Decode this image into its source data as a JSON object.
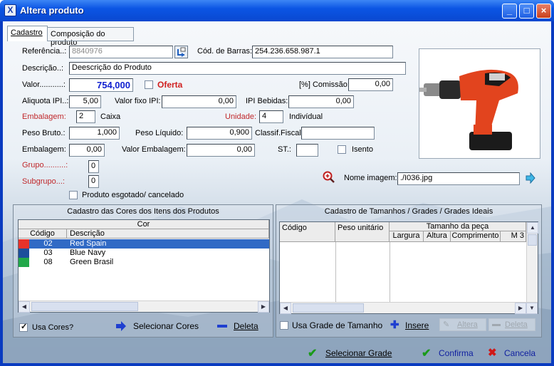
{
  "window": {
    "title": "Altera produto"
  },
  "tabs": [
    "Cadastro",
    "Composição do produto"
  ],
  "form": {
    "referencia_label": "Referência..:",
    "referencia_value": "8840976",
    "cod_barras_label": "Cód. de Barras:",
    "cod_barras_value": "254.236.658.987.1",
    "descricao_label": "Descrição..:",
    "descricao_value": "Deescrição do Produto",
    "valor_label": "Valor...........:",
    "valor_value": "754,000",
    "oferta_label": "Oferta",
    "comissao_label": "[%] Comissão:",
    "comissao_value": "0,00",
    "aliquota_label": "Aliquota IPI..:",
    "aliquota_value": "5,00",
    "valor_fixo_label": "Valor fixo IPI:",
    "valor_fixo_value": "0,00",
    "ipi_bebidas_label": "IPI Bebidas:",
    "ipi_bebidas_value": "0,00",
    "embalagem_label": "Embalagem:",
    "embalagem_value": "2",
    "embalagem_unit": "Caixa",
    "unidade_label": "Unidade:",
    "unidade_value": "4",
    "unidade_unit": "Indivídual",
    "peso_bruto_label": "Peso Bruto.:",
    "peso_bruto_value": "1,000",
    "peso_liquido_label": "Peso Líquido:",
    "peso_liquido_value": "0,900",
    "classif_label": "Classif.Fiscal:",
    "classif_value": "",
    "embalagem2_label": "Embalagem:",
    "embalagem2_value": "0,00",
    "valor_embalagem_label": "Valor Embalagem:",
    "valor_embalagem_value": "0,00",
    "st_label": "ST.:",
    "st_value": "",
    "isento_label": "Isento",
    "grupo_label": "Grupo..........:",
    "grupo_value": "0",
    "subgrupo_label": "Subgrupo...:",
    "subgrupo_value": "0",
    "esgotado_label": "Produto esgotado/ cancelado",
    "nome_imagem_label": "Nome imagem:",
    "nome_imagem_value": "./I036.jpg"
  },
  "cores": {
    "title": "Cadastro das Cores dos Itens dos Produtos",
    "header_group": "Cor",
    "columns": [
      "Código",
      "Descrição"
    ],
    "rows": [
      {
        "codigo": "02",
        "descricao": "Red Spain",
        "color": "#e8322a"
      },
      {
        "codigo": "03",
        "descricao": "Blue Navy",
        "color": "#1c4f9c"
      },
      {
        "codigo": "08",
        "descricao": "Green Brasil",
        "color": "#22a84a"
      }
    ],
    "usa_cores_label": "Usa Cores?",
    "selecionar_label": "Selecionar Cores",
    "deleta_label": "Deleta"
  },
  "tamanhos": {
    "title": "Cadastro de Tamanhos / Grades / Grades Ideais",
    "col_codigo": "Código",
    "col_peso": "Peso unitário",
    "group_tamanho": "Tamanho da peça",
    "sub_columns": [
      "Largura",
      "Altura",
      "Comprimento",
      "M 3"
    ],
    "usa_grade_label": "Usa Grade de Tamanho",
    "insere_label": "Insere",
    "altera_label": "Altera",
    "deleta_label": "Deleta"
  },
  "footer": {
    "selecionar_grade": "Selecionar Grade",
    "confirma": "Confirma",
    "cancela": "Cancela"
  }
}
